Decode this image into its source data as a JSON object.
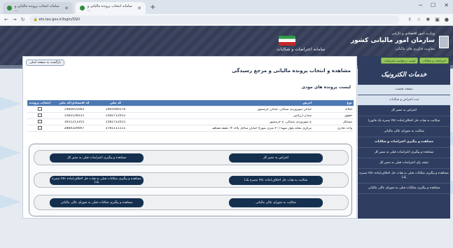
{
  "browser": {
    "tabs": [
      {
        "label": "سامانه انتخاب پرونده مالیاتی و ..."
      },
      {
        "label": "سامانه انتخاب پرونده مالیاتی و ..."
      }
    ],
    "new_tab": "+",
    "url": "ets.tax.gov.ir/login/SSO",
    "controls": {
      "minimize": "─",
      "maximize": "☐",
      "close": "✕"
    }
  },
  "banner": {
    "ministry": "وزارت امور اقتصادی و دارایی",
    "org": "سازمان امور مالیاتی کشور",
    "sub": "معاونت فناوری های مالیاتی",
    "system_name": "سامانه اعتراضات و شکایات"
  },
  "sidebar": {
    "tabs": [
      "اعتراضات و شکایات",
      "لیست درخواست اعتراضات"
    ],
    "header": "خدمات الکترونیک",
    "items": [
      {
        "label": "صفحه نخست",
        "style": "light"
      },
      {
        "label": "ثبت اعتراض و شکایات",
        "style": "light"
      },
      {
        "label": "اعتراض به ممیز کل",
        "style": "normal"
      },
      {
        "label": "شکایت به هیات حل اختلاف(ماده ۲۵۱ تبصره یک قانون)",
        "style": "normal"
      },
      {
        "label": "شکایت به شورای عالی مالیاتی",
        "style": "normal"
      },
      {
        "label": "مشاهده و پیگیری اعتراضات و شکایات",
        "style": "section"
      },
      {
        "label": "مشاهده و پیگیری اعتراضات قبلی به ممیز کل",
        "style": "normal"
      },
      {
        "label": "نتیجه رای اعتراضات قبلی به ممیز کل",
        "style": "normal"
      },
      {
        "label": "مشاهده و پیگیری شکایات قبلی به هیات حل اختلاف(ماده ۲۵۱ تبصره یک)",
        "style": "normal"
      },
      {
        "label": "مشاهده و پیگیری شکایات قبلی به شورای عالی مالیاتی",
        "style": "normal"
      }
    ]
  },
  "content": {
    "back": "بازگشت به صفحه اصلی",
    "title": "مشاهده و انتخاب پرونده مالیاتی و مرجع رسیدگی",
    "section_title": "لیست پرونده های مودی",
    "table": {
      "headers": [
        "نوع",
        "آدرس",
        "کد ملی",
        "کد اقتصادی/کد ملی",
        "انتخاب پرونده"
      ],
      "rows": [
        {
          "type": "املاک",
          "address": "خیابان سهروردی شمالی، خیابان خرمشهر",
          "national": "1465946576",
          "economic": "1460055065",
          "select": ""
        },
        {
          "type": "حقوق",
          "address": "میدان آرژانتین",
          "national": "1582712011",
          "economic": "1582128221",
          "select": ""
        },
        {
          "type": "مشاغل",
          "address": "خ سهروردی شمالی، خ خرمشهر",
          "national": "1582712011",
          "economic": "1651213355",
          "select": ""
        },
        {
          "type": "واحد تجاری",
          "address": "مرکزی محله بلوار شهدا (۲۰ متری شورا) خیابان ساحل پلاک ۱۴ طبقه همکف",
          "national": "3781111111",
          "economic": "2884329007",
          "select": ""
        }
      ]
    },
    "actions": [
      {
        "right": "اعتراض به ممیز کل",
        "left": "مشاهده و پیگیری اعتراضات قبلی به ممیز کل"
      },
      {
        "right": "شکایت به هیات حل اختلاف(ماده ۲۵۱ تبصره یک)",
        "left": "مشاهده و پیگیری شکایات قبلی به هیات حل اختلاف(ماده ۲۵۱ تبصره یک)"
      },
      {
        "right": "شکایت به شورای عالی مالیاتی",
        "left": "مشاهده و پیگیری شکایات قبلی به شورای عالی مالیاتی"
      }
    ]
  },
  "colors": {
    "sidebar": "#2f3e60",
    "table_header": "#4c78b4",
    "button": "#15304f",
    "accent_green": "#98c95b"
  }
}
